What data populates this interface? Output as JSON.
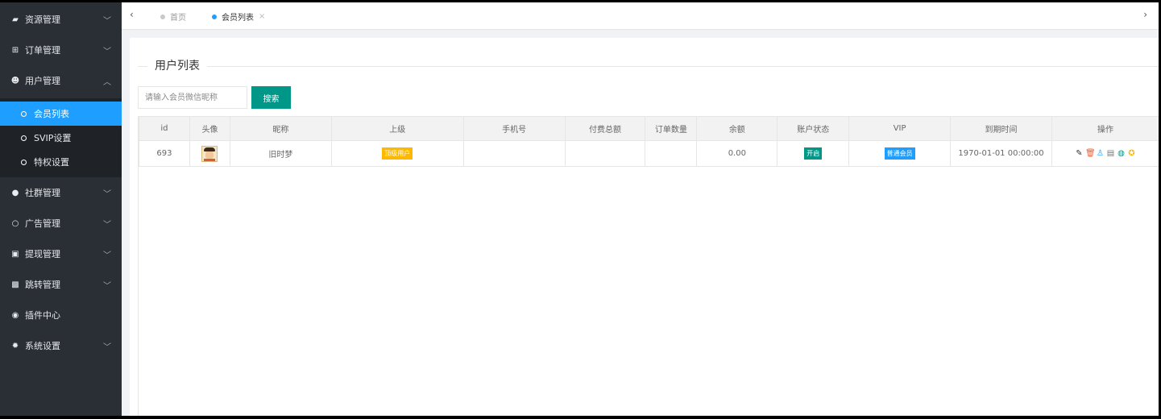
{
  "sidebar": {
    "items": [
      {
        "label": "资源管理",
        "icon": "book-icon",
        "glyph": "▰",
        "chevron": "﹀"
      },
      {
        "label": "订单管理",
        "icon": "cart-icon",
        "glyph": "⊞",
        "chevron": "﹀"
      },
      {
        "label": "用户管理",
        "icon": "users-icon",
        "glyph": "☻",
        "chevron": "︿"
      },
      {
        "label": "社群管理",
        "icon": "chat-icon",
        "glyph": "●",
        "chevron": "﹀"
      },
      {
        "label": "广告管理",
        "icon": "circle-icon",
        "glyph": "○",
        "chevron": "﹀"
      },
      {
        "label": "提现管理",
        "icon": "cash-icon",
        "glyph": "▣",
        "chevron": "﹀"
      },
      {
        "label": "跳转管理",
        "icon": "image-icon",
        "glyph": "▩",
        "chevron": "﹀"
      },
      {
        "label": "插件中心",
        "icon": "plugin-icon",
        "glyph": "◉",
        "chevron": ""
      },
      {
        "label": "系统设置",
        "icon": "gear-icon",
        "glyph": "✹",
        "chevron": "﹀"
      }
    ],
    "subitems": [
      {
        "label": "会员列表",
        "active": true
      },
      {
        "label": "SVIP设置",
        "active": false
      },
      {
        "label": "特权设置",
        "active": false
      }
    ]
  },
  "topbar": {
    "tabs": [
      {
        "label": "首页",
        "dot_color": "#c9c9c9",
        "text_color": "#999999"
      },
      {
        "label": "会员列表",
        "dot_color": "#1e9fff",
        "text_color": "#333333",
        "close": "×"
      }
    ],
    "left_arrow": "‹",
    "right_arrow": "›"
  },
  "main": {
    "title": "用户列表",
    "search_placeholder": "请输入会员微信昵称",
    "search_button": "搜索",
    "columns": [
      "id",
      "头像",
      "昵称",
      "上级",
      "手机号",
      "付费总额",
      "订单数量",
      "余额",
      "账户状态",
      "VIP",
      "到期时间",
      "操作"
    ],
    "rows": [
      {
        "id": "693",
        "nickname": "旧时梦",
        "superior": "顶级用户",
        "phone": "",
        "total_paid": "",
        "order_count": "",
        "balance": "0.00",
        "status": "开启",
        "vip": "普通会员",
        "expire": "1970-01-01 00:00:00"
      }
    ]
  },
  "colors": {
    "superior_tag": "#ffb800",
    "status_tag": "#009688",
    "vip_tag": "#1e9fff",
    "accent": "#1e9fff"
  },
  "ops_icons": [
    {
      "name": "edit-icon",
      "glyph": "✎",
      "color": "#333333"
    },
    {
      "name": "delete-icon",
      "glyph": "🗑",
      "color": "#ff5722"
    },
    {
      "name": "user-icon",
      "glyph": "♙",
      "color": "#1e9fff"
    },
    {
      "name": "document-icon",
      "glyph": "▤",
      "color": "#777777"
    },
    {
      "name": "badge-icon",
      "glyph": "◍",
      "color": "#009688"
    },
    {
      "name": "coin-icon",
      "glyph": "✪",
      "color": "#ffb800"
    }
  ]
}
